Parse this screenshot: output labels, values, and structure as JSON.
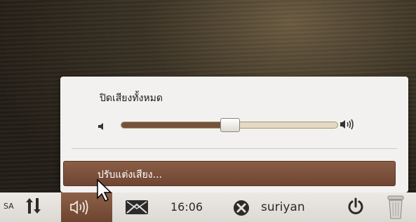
{
  "sound_menu": {
    "mute_all_label": "ปิดเสียงทั้งหมด",
    "volume_level_percent": 50,
    "volume_low_icon": "speaker-low-icon",
    "volume_high_icon": "speaker-high-icon",
    "sound_settings_label": "ปรับแต่งเสียง..."
  },
  "panel": {
    "keyboard_layout": "SA",
    "clock": "16:06",
    "user_name": "suriyan",
    "icons": [
      "network-icon",
      "sound-icon",
      "mail-icon",
      "user-close-icon",
      "power-icon",
      "trash-icon"
    ]
  },
  "colors": {
    "accent_brown": "#75523c",
    "menu_background": "#f2f1ef",
    "panel_background": "#e4e1dc"
  }
}
